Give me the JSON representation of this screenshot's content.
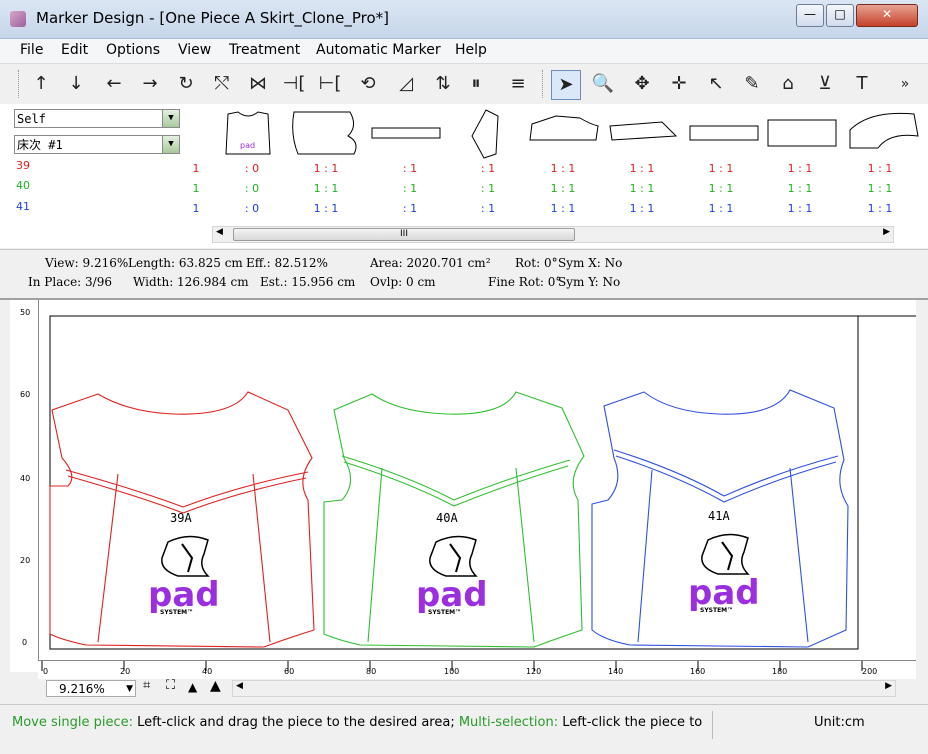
{
  "window": {
    "title": "Marker Design - [One Piece A Skirt_Clone_Pro*]",
    "minimize_glyph": "—",
    "maximize_glyph": "□",
    "close_glyph": "✕"
  },
  "menu": [
    "File",
    "Edit",
    "Options",
    "View",
    "Treatment",
    "Automatic Marker",
    "Help"
  ],
  "toolbar": {
    "left_tools": [
      "↑",
      "↓",
      "←",
      "→",
      "↻",
      "⤲",
      "⋈",
      "⊣[",
      "⊢[",
      "⟲",
      "◿",
      "⇅",
      "⏸",
      "≡"
    ],
    "right_tools": [
      "➤",
      "🔍",
      "✥",
      "✛",
      "↖",
      "✎",
      "⌂",
      "⊻",
      "T"
    ],
    "more": "»"
  },
  "combos": {
    "layer": "Self",
    "table": "床次 #1"
  },
  "sizes": [
    {
      "name": "39",
      "color": "#e02020",
      "first": "1",
      "second": ": 0",
      "ratios": [
        "1 : 1",
        ": 1",
        ": 1",
        "1 : 1",
        "1 : 1",
        "1 : 1",
        "1 : 1",
        "1 : 1"
      ]
    },
    {
      "name": "40",
      "color": "#20b020",
      "first": "1",
      "second": ": 0",
      "ratios": [
        "1 : 1",
        ": 1",
        ": 1",
        "1 : 1",
        "1 : 1",
        "1 : 1",
        "1 : 1",
        "1 : 1"
      ]
    },
    {
      "name": "41",
      "color": "#2040e0",
      "first": "1",
      "second": ": 0",
      "ratios": [
        "1 : 1",
        ": 1",
        ": 1",
        "1 : 1",
        "1 : 1",
        "1 : 1",
        "1 : 1",
        "1 : 1"
      ]
    }
  ],
  "piece_thumb_label": "pad",
  "scroll_glyph": "III",
  "info": {
    "view": "View:  9.216%",
    "length": "Length:  63.825 cm",
    "eff": "Eff.:  82.512%",
    "area": "Area:  2020.701 cm²",
    "rot": "Rot:  0°",
    "symx": "Sym X:  No",
    "inplace": "In Place:  3/96",
    "width": "Width:  126.984 cm",
    "est": "Est.:  15.956 cm",
    "ovlp": "Ovlp:  0 cm",
    "finerot": "Fine Rot:  0°",
    "symy": "Sym Y:  No"
  },
  "pieces": [
    {
      "label": "39A",
      "color": "#e02020"
    },
    {
      "label": "40A",
      "color": "#30c030"
    },
    {
      "label": "41A",
      "color": "#3050e0"
    }
  ],
  "logo": {
    "text": "pad",
    "sub": "SYSTEM™",
    "color": "#9b2fe0"
  },
  "vruler_ticks": [
    "50",
    "60",
    "40",
    "20",
    "0"
  ],
  "hruler_ticks": [
    "0",
    "20",
    "40",
    "60",
    "80",
    "100",
    "120",
    "140",
    "160",
    "180",
    "200"
  ],
  "zoom": "9.216%",
  "status": {
    "part1": "Move single piece:",
    "part2": " Left-click and drag the piece to the desired area; ",
    "part3": "Multi-selection:",
    "part4": " Left-click the piece to",
    "unit": "Unit:cm",
    "highlight_color": "#2a9a2a"
  }
}
